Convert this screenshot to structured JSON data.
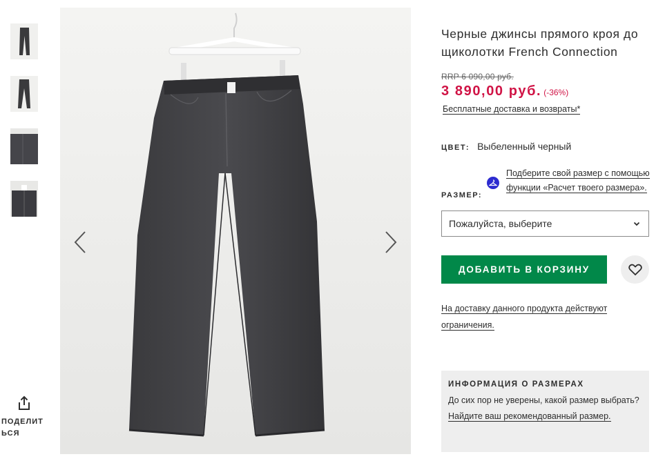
{
  "thumbnails": [
    {
      "alt": "thumbnail-1"
    },
    {
      "alt": "thumbnail-2"
    },
    {
      "alt": "thumbnail-3"
    },
    {
      "alt": "thumbnail-4"
    }
  ],
  "share": {
    "label": "ПОДЕЛИТ\nЬСЯ",
    "icon": "share-icon"
  },
  "gallery": {
    "prev_icon": "chevron-left-icon",
    "next_icon": "chevron-right-icon"
  },
  "product": {
    "title": "Черные джинсы прямого кроя до щиколотки French Connection",
    "rrp": "RRP 6 090,00 руб.",
    "price": "3 890,00 руб.",
    "discount": "(-36%)",
    "delivery_link": "Бесплатные доставка и возвраты*",
    "color_label": "ЦВЕТ:",
    "color_value": "Выбеленный черный",
    "size_label": "РАЗМЕР:",
    "fit_link": "Подберите свой размер с помощью функции «Расчет твоего размера».",
    "size_select": "Пожалуйста, выберите",
    "add_to_cart": "ДОБАВИТЬ В КОРЗИНУ",
    "restriction": "На доставку данного продукта действуют ограничения."
  },
  "size_info": {
    "title": "ИНФОРМАЦИЯ О РАЗМЕРАХ",
    "text": "До сих пор не уверены, какой размер выбрать?",
    "link": "Найдите ваш рекомендованный размер."
  },
  "colors": {
    "price_red": "#d01345",
    "cart_green": "#018849",
    "fit_icon_blue": "#2d2bd0"
  }
}
